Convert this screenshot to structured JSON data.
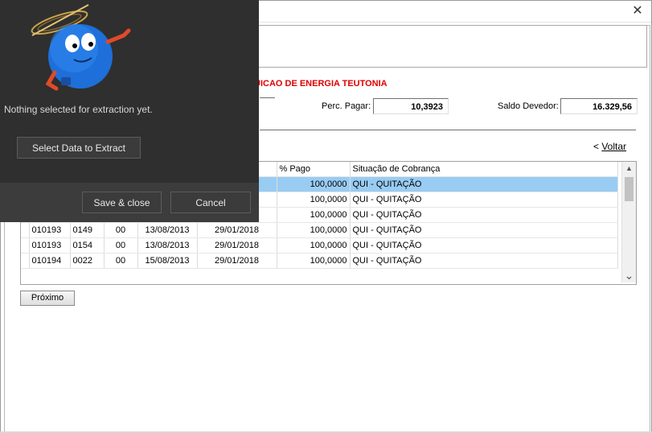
{
  "window": {
    "close_glyph": "✕",
    "company_name": "UICAO DE ENERGIA TEUTONIA",
    "perc_pagar_label": "Perc. Pagar:",
    "perc_pagar_value": "10,3923",
    "saldo_devedor_label": "Saldo Devedor:",
    "saldo_devedor_value": "16.329,56",
    "voltar_prefix": "< ",
    "voltar_label": "Voltar",
    "proximo_label": "Próximo"
  },
  "grid": {
    "headers": [
      "",
      "",
      "",
      "",
      "o",
      "% Pago",
      "Situação de Cobrança"
    ],
    "rows": [
      {
        "c1": "",
        "c2": "",
        "c3": "",
        "c4": "",
        "c5": "",
        "pago": "100,0000",
        "situacao": "QUI - QUITAÇÃO",
        "selected": true
      },
      {
        "c1": "",
        "c2": "",
        "c3": "",
        "c4": "",
        "c5": "",
        "pago": "100,0000",
        "situacao": "QUI - QUITAÇÃO",
        "selected": false
      },
      {
        "c1": "",
        "c2": "",
        "c3": "",
        "c4": "",
        "c5": "",
        "pago": "100,0000",
        "situacao": "QUI - QUITAÇÃO",
        "selected": false
      },
      {
        "c1": "010193",
        "c2": "0149",
        "c3": "00",
        "c4": "13/08/2013",
        "c5": "29/01/2018",
        "pago": "100,0000",
        "situacao": "QUI - QUITAÇÃO",
        "selected": false
      },
      {
        "c1": "010193",
        "c2": "0154",
        "c3": "00",
        "c4": "13/08/2013",
        "c5": "29/01/2018",
        "pago": "100,0000",
        "situacao": "QUI - QUITAÇÃO",
        "selected": false
      },
      {
        "c1": "010194",
        "c2": "0022",
        "c3": "00",
        "c4": "15/08/2013",
        "c5": "29/01/2018",
        "pago": "100,0000",
        "situacao": "QUI - QUITAÇÃO",
        "selected": false
      }
    ],
    "scroll_up_glyph": "▲",
    "scroll_down_glyph": "⌄"
  },
  "extract_panel": {
    "status_text": "Nothing selected for extraction yet.",
    "select_button_label": "Select Data to Extract",
    "save_button_label": "Save & close",
    "cancel_button_label": "Cancel",
    "mascot_icon": "blue-ball-mascot-icon"
  }
}
